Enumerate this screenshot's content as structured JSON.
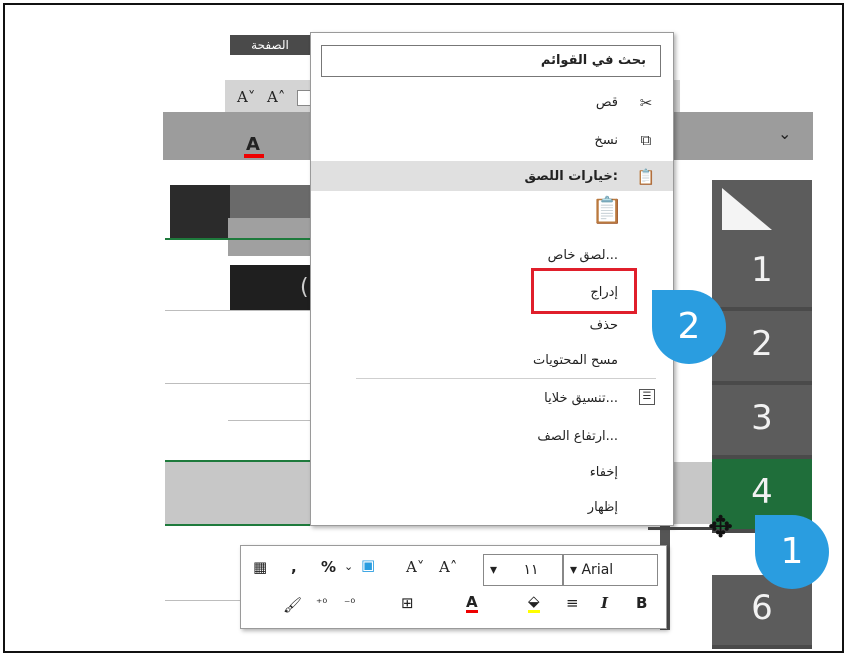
{
  "ribbon": {
    "tab_label": "الصفحة",
    "font_grow": "A˄",
    "font_shrink": "A˅",
    "font_color_glyph": "A",
    "namebox_chevron": "⌄"
  },
  "context_menu": {
    "search_label": "بحث في القوائم",
    "items": [
      {
        "label": "قص",
        "icon": "scissors-icon"
      },
      {
        "label": "نسخ",
        "icon": "copy-icon"
      },
      {
        "label": "خيارات اللصق:",
        "icon": "paste-icon"
      },
      {
        "label": "لصق خاص...",
        "icon": ""
      },
      {
        "label": "إدراج",
        "icon": ""
      },
      {
        "label": "حذف",
        "icon": ""
      },
      {
        "label": "مسح المحتويات",
        "icon": ""
      },
      {
        "label": "تنسيق خلايا...",
        "icon": "format-cells-icon"
      },
      {
        "label": "ارتفاع الصف...",
        "icon": ""
      },
      {
        "label": "إخفاء",
        "icon": ""
      },
      {
        "label": "إظهار",
        "icon": ""
      }
    ]
  },
  "mini_toolbar": {
    "font_name": "Arial",
    "font_size": "١١",
    "row1_glyphs": [
      "A˄",
      "A˅",
      "%",
      ","
    ],
    "row2_glyphs": [
      "B",
      "I",
      "≡",
      "A"
    ]
  },
  "row_headers": [
    "1",
    "2",
    "3",
    "4",
    "6"
  ],
  "selected_row": "4",
  "callouts": [
    "1",
    "2"
  ],
  "colors": {
    "row_header_bg": "#5c5c5c",
    "selected_row_bg": "#1f6e3a",
    "callout_bg": "#2a9de0",
    "highlight_border": "#e01f2b"
  }
}
